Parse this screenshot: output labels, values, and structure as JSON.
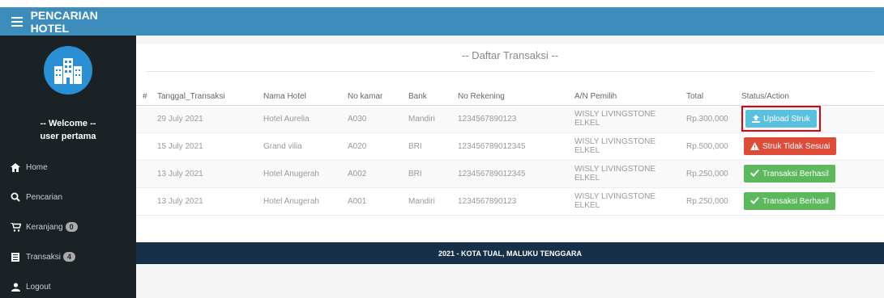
{
  "app": {
    "title": "PENCARIAN HOTEL"
  },
  "sidebar": {
    "welcome": "-- Welcome --",
    "username": "user pertama",
    "items": [
      {
        "label": "Home",
        "icon": "home-icon"
      },
      {
        "label": "Pencarian",
        "icon": "search-icon"
      },
      {
        "label": "Keranjang",
        "icon": "cart-icon",
        "badge": "0"
      },
      {
        "label": "Transaksi",
        "icon": "list-icon",
        "badge": "4"
      },
      {
        "label": "Logout",
        "icon": "user-icon"
      }
    ]
  },
  "panel": {
    "title": "-- Daftar Transaksi --"
  },
  "table": {
    "headers": [
      "#",
      "Tanggal_Transaksi",
      "Nama Hotel",
      "No kamar",
      "Bank",
      "No Rekening",
      "A/N Pemilih",
      "Total",
      "Status/Action"
    ],
    "rows": [
      {
        "date": "29 July 2021",
        "hotel": "Hotel Aurelia",
        "room": "A030",
        "bank": "Mandiri",
        "account": "1234567890123",
        "owner": "WISLY LIVINGSTONE ELKEL",
        "total": "Rp.300,000",
        "action": "Upload Struk"
      },
      {
        "date": "15 July 2021",
        "hotel": "Grand vilia",
        "room": "A020",
        "bank": "BRI",
        "account": "123456789012345",
        "owner": "WISLY LIVINGSTONE ELKEL",
        "total": "Rp.500,000",
        "action": "Struk Tidak Sesuai"
      },
      {
        "date": "13 July 2021",
        "hotel": "Hotel Anugerah",
        "room": "A002",
        "bank": "BRI",
        "account": "123456789012345",
        "owner": "WISLY LIVINGSTONE ELKEL",
        "total": "Rp.250,000",
        "action": "Transaksi Berhasil"
      },
      {
        "date": "13 July 2021",
        "hotel": "Hotel Anugerah",
        "room": "A001",
        "bank": "Mandiri",
        "account": "1234567890123",
        "owner": "WISLY LIVINGSTONE ELKEL",
        "total": "Rp.250,000",
        "action": "Transaksi Berhasil"
      }
    ]
  },
  "footer": {
    "text": "2021 - KOTA TUAL, MALUKU TENGGARA"
  },
  "colors": {
    "primary": "#3c8dbc",
    "sidebar": "#1a2226",
    "info": "#5bc0de",
    "danger": "#dd4b39",
    "success": "#5cb85c",
    "footer": "#17304a"
  }
}
